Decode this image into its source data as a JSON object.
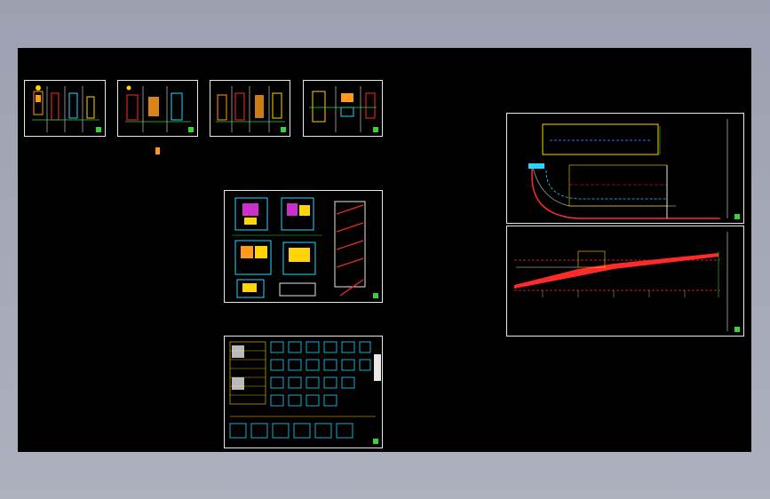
{
  "app": {
    "canvas_background": "#000000",
    "chrome_color": "#a3a8b6"
  },
  "colors": {
    "line": "#e8e8e8",
    "red": "#ff2a2a",
    "yellow": "#ffd400",
    "cyan": "#2ad4ff",
    "green": "#36d13a",
    "orange": "#ff9a1a",
    "blue": "#3b6bff",
    "magenta": "#ff3bff"
  },
  "sheets": [
    {
      "id": "elevation-1",
      "kind": "elevation"
    },
    {
      "id": "elevation-2",
      "kind": "elevation"
    },
    {
      "id": "elevation-3",
      "kind": "elevation"
    },
    {
      "id": "elevation-4",
      "kind": "elevation"
    },
    {
      "id": "floor-plans",
      "kind": "plan"
    },
    {
      "id": "detail-table",
      "kind": "table"
    },
    {
      "id": "ramp-plan",
      "kind": "ramp-plan"
    },
    {
      "id": "ramp-section",
      "kind": "ramp-section"
    }
  ]
}
